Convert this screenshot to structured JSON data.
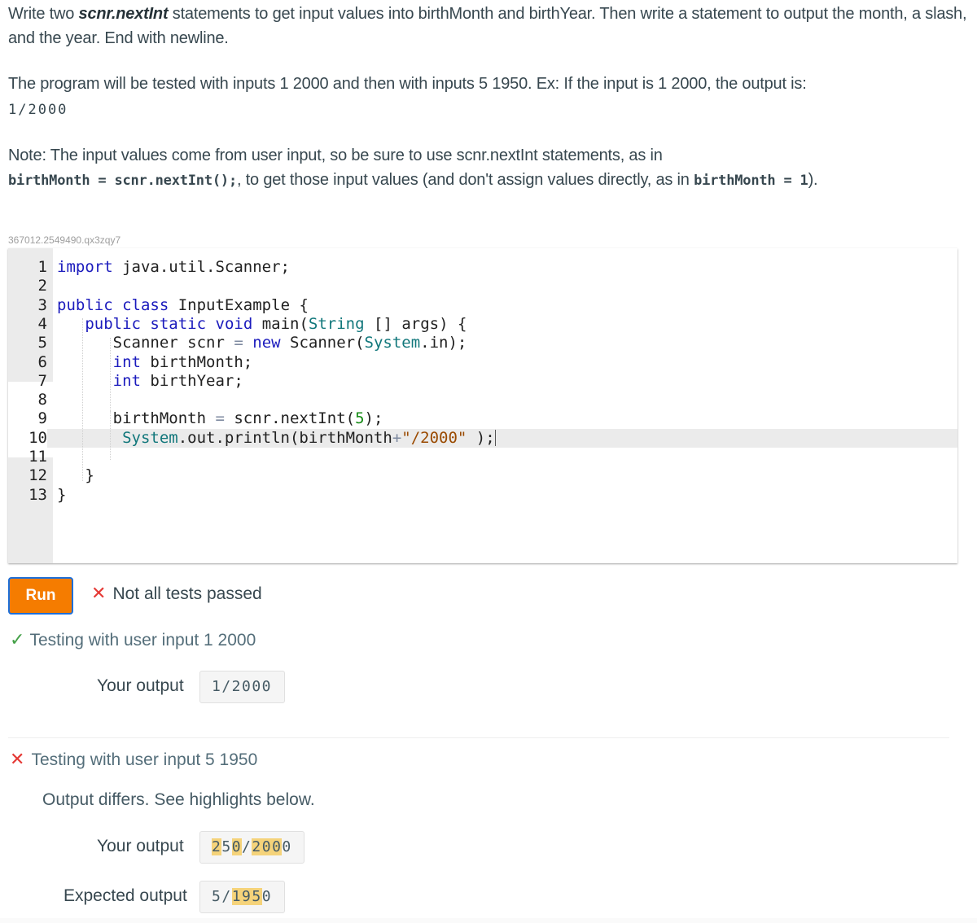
{
  "instructions": {
    "p1_pre": "Write two ",
    "p1_bold": "scnr.nextInt",
    "p1_post": " statements to get input values into birthMonth and birthYear. Then write a statement to output the month, a slash, and the year. End with newline.",
    "p2_text": "The program will be tested with inputs 1 2000 and then with inputs 5 1950. Ex: If the input is 1 2000, the output is:",
    "p2_example": "1/2000",
    "p3_text": "Note: The input values come from user input, so be sure to use scnr.nextInt statements, as in",
    "p3_code1": "birthMonth = scnr.nextInt();",
    "p3_mid": ", to get those input values (and don't assign values directly, as in ",
    "p3_code2": "birthMonth = 1",
    "p3_end": ")."
  },
  "challenge_id": "367012.2549490.qx3zqy7",
  "editor": {
    "line_numbers": [
      "1",
      "2",
      "3",
      "4",
      "5",
      "6",
      "7",
      "8",
      "9",
      "10",
      "11",
      "12",
      "13"
    ],
    "lines": [
      "import java.util.Scanner;",
      "",
      "public class InputExample {",
      "   public static void main(String [] args) {",
      "      Scanner scnr = new Scanner(System.in);",
      "      int birthMonth;",
      "      int birthYear;",
      "",
      "      birthMonth = scnr.nextInt(5);",
      "       System.out.println(birthMonth+\"/2000\" );",
      "",
      "   }",
      "}"
    ],
    "active_line": 10
  },
  "run_button": {
    "label": "Run"
  },
  "status": {
    "icon": "x-icon",
    "text": "Not all tests passed"
  },
  "tests": [
    {
      "passed": true,
      "title": "Testing with user input 1 2000",
      "your_output_label": "Your output",
      "your_output": "1/2000"
    },
    {
      "passed": false,
      "title": "Testing with user input 5 1950",
      "message": "Output differs. See highlights below.",
      "your_output_label": "Your output",
      "your_output": "250/2000",
      "your_output_highlighted_chars": [
        0,
        2,
        4,
        5,
        6
      ],
      "expected_output_label": "Expected output",
      "expected_output": "5/1950",
      "expected_output_highlighted_chars": [
        2,
        3,
        4
      ]
    }
  ],
  "colors": {
    "run_button": "#f57c00",
    "run_button_border": "#1e6fd9",
    "fail": "#e53935",
    "pass": "#43a047",
    "highlight": "#f5d37a"
  }
}
